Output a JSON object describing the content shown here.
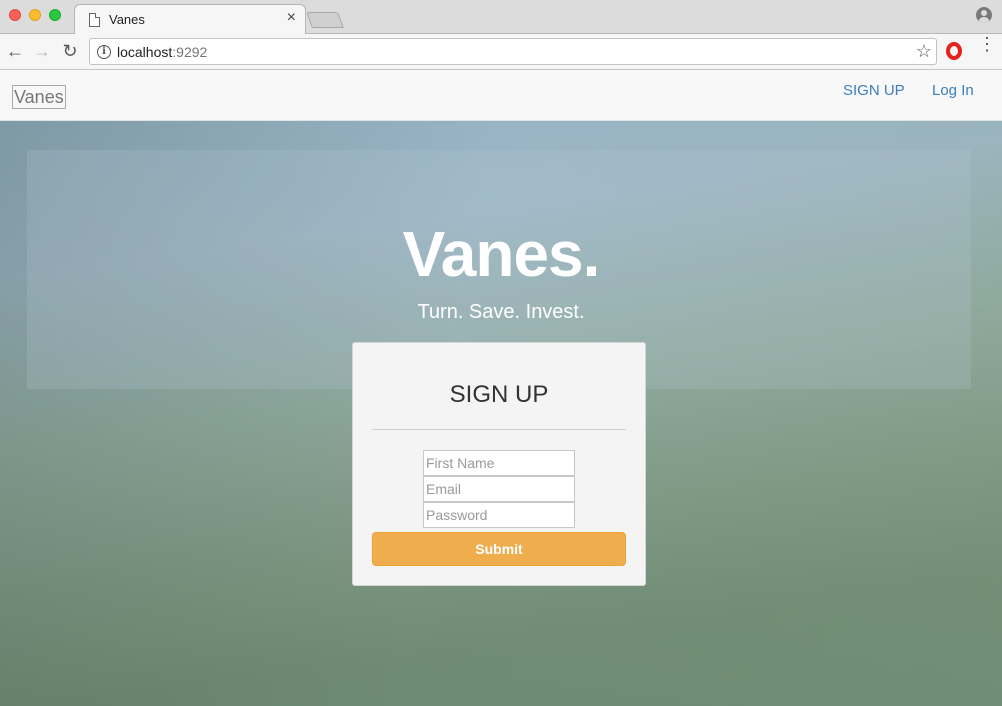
{
  "browser": {
    "tab_title": "Vanes",
    "tab_close": "×",
    "url_host": "localhost",
    "url_port": ":9292"
  },
  "navbar": {
    "brand": "Vanes",
    "links": [
      {
        "label": "SIGN UP"
      },
      {
        "label": "Log In"
      }
    ],
    "link_color": "#3b7ebd"
  },
  "hero": {
    "title": "Vanes.",
    "tagline": "Turn. Save. Invest."
  },
  "signup_form": {
    "title": "SIGN UP",
    "fields": [
      {
        "placeholder": "First Name",
        "value": ""
      },
      {
        "placeholder": "Email",
        "value": ""
      },
      {
        "placeholder": "Password",
        "value": ""
      }
    ],
    "submit_label": "Submit",
    "submit_color": "#f0ad4e"
  },
  "icons": [
    "back-arrow-icon",
    "forward-arrow-icon",
    "reload-icon",
    "info-icon",
    "star-icon",
    "opera-icon",
    "menu-dots-icon",
    "profile-icon",
    "page-icon",
    "close-icon"
  ]
}
